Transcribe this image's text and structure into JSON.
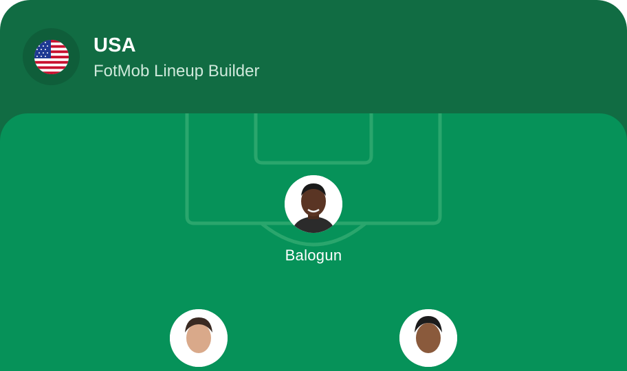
{
  "header": {
    "team_name": "USA",
    "subtitle": "FotMob Lineup Builder",
    "flag_icon": "us-flag-icon"
  },
  "pitch": {
    "players": [
      {
        "name": "Balogun",
        "avatar": "player-photo"
      },
      {
        "name": "",
        "avatar": "player-photo"
      },
      {
        "name": "",
        "avatar": "player-photo"
      }
    ]
  },
  "colors": {
    "header_bg": "#116c43",
    "pitch_bg": "#069259",
    "pitch_lines": "#2aa66d",
    "text_primary": "#ffffff",
    "text_secondary": "#cfe9db"
  }
}
